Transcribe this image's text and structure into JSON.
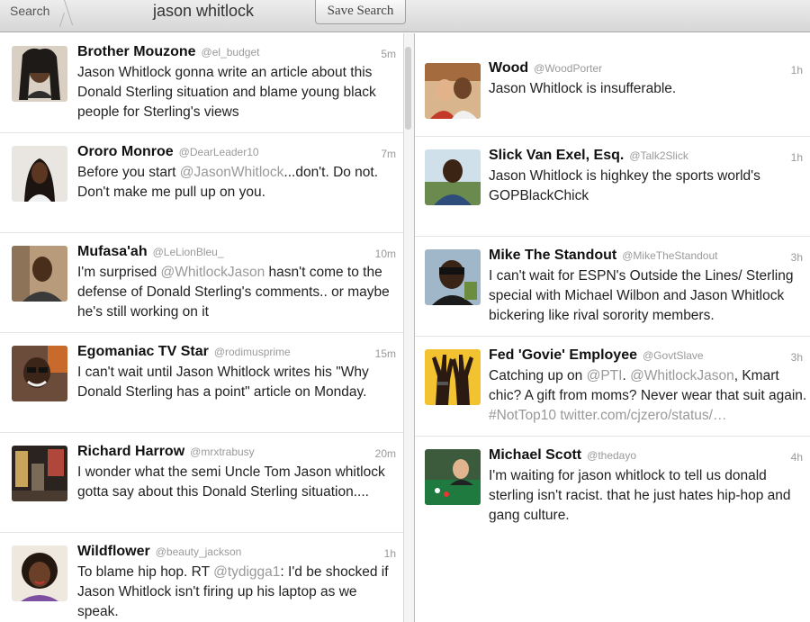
{
  "toolbar": {
    "crumb_label": "Search",
    "query": "jason whitlock",
    "save_label": "Save Search"
  },
  "left_tweets": [
    {
      "name": "Brother Mouzone",
      "handle": "@el_budget",
      "time": "5m",
      "text": "Jason Whitlock gonna write an article about this Donald Sterling situation and blame young black people for Sterling's views"
    },
    {
      "name": "Ororo Monroe",
      "handle": "@DearLeader10",
      "time": "7m",
      "pre": "Before you start ",
      "mention": "@JasonWhitlock",
      "post": "...don't. Do not. Don't make me pull up on you."
    },
    {
      "name": "Mufasa'ah",
      "handle": "@LeLionBleu_",
      "time": "10m",
      "pre": "I'm surprised ",
      "mention": "@WhitlockJason",
      "post": " hasn't come to the defense of Donald Sterling's comments.. or maybe he's still working on it"
    },
    {
      "name": "Egomaniac TV Star",
      "handle": "@rodimusprime",
      "time": "15m",
      "text": "I can't wait until Jason Whitlock writes his \"Why Donald Sterling has a point\" article on Monday."
    },
    {
      "name": "Richard Harrow",
      "handle": "@mrxtrabusy",
      "time": "20m",
      "text": "I wonder what the semi Uncle Tom Jason whitlock gotta say about this Donald Sterling situation...."
    },
    {
      "name": "Wildflower",
      "handle": "@beauty_jackson",
      "time": "1h",
      "pre": "To blame hip hop. RT ",
      "mention": "@tydigga1",
      "post": ": I'd be shocked if Jason Whitlock isn't firing up his laptop as we speak."
    }
  ],
  "right_tweets": [
    {
      "name": "Wood",
      "handle": "@WoodPorter",
      "time": "1h",
      "text": "Jason Whitlock is insufferable."
    },
    {
      "name": "Slick Van Exel, Esq.",
      "handle": "@Talk2Slick",
      "time": "1h",
      "text": "Jason Whitlock is highkey the sports world's GOPBlackChick"
    },
    {
      "name": "Mike The Standout",
      "handle": "@MikeTheStandout",
      "time": "3h",
      "text": "I can't wait for ESPN's Outside the Lines/ Sterling special with Michael Wilbon and Jason Whitlock bickering like rival sorority members."
    },
    {
      "name": "Fed 'Govie' Employee",
      "handle": "@GovtSlave",
      "time": "3h",
      "pre": "Catching up on ",
      "mention": "@PTI",
      "mid": ". ",
      "mention2": "@WhitlockJason",
      "post": ", Kmart chic? A gift from moms? Never wear that suit again. ",
      "tail": "#NotTop10 twitter.com/cjzero/status/…"
    },
    {
      "name": "Michael Scott",
      "handle": "@thedayo",
      "time": "4h",
      "text": "I'm waiting for jason whitlock to tell us donald sterling isn't racist. that he just hates hip-hop and gang culture."
    }
  ]
}
